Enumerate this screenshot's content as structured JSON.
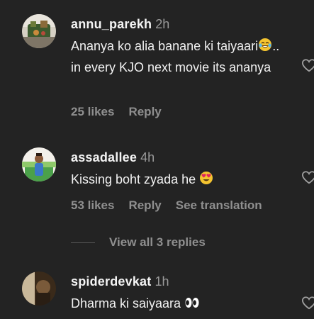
{
  "comments": [
    {
      "username": "annu_parekh",
      "time": "2h",
      "text_before": "Ananya ko alia banane ki taiyaari",
      "emoji": "laughing-tears-emoji",
      "text_after": ".. in every KJO next movie its ananya",
      "likes": "25 likes",
      "reply": "Reply"
    },
    {
      "username": "assadallee",
      "time": "4h",
      "text_before": "Kissing boht zyada he ",
      "emoji": "heart-eyes-emoji",
      "text_after": "",
      "likes": "53 likes",
      "reply": "Reply",
      "translate": "See translation"
    },
    {
      "username": "spiderdevkat",
      "time": "1h",
      "text_before": "Dharma ki saiyaara ",
      "emoji": "eyes-emoji",
      "text_after": ""
    }
  ],
  "view_replies": "View all 3 replies",
  "colors": {
    "background": "#232323",
    "text": "#f2f2f2",
    "muted": "#8f8f8f",
    "time": "#9a9a9a"
  }
}
